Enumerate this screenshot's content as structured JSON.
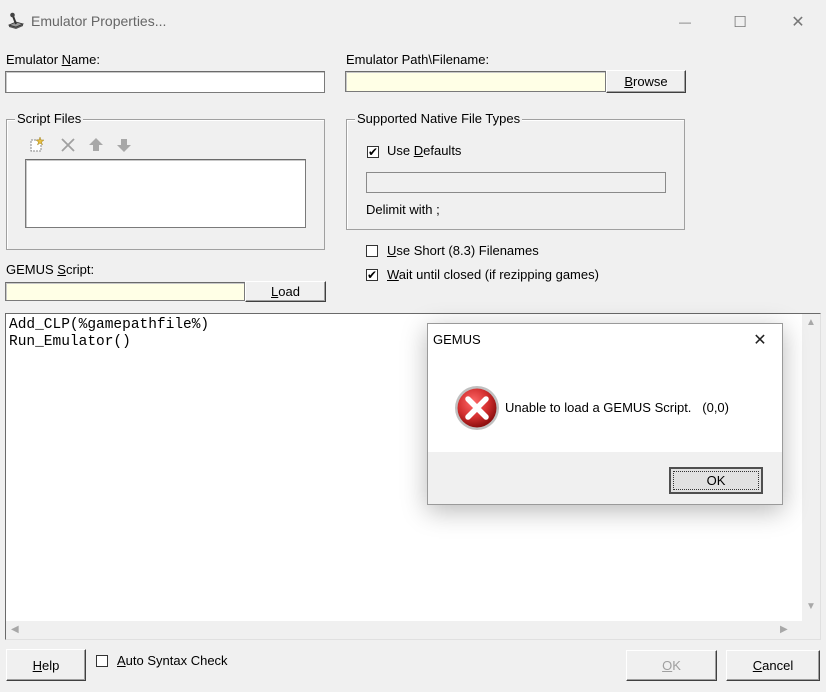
{
  "window": {
    "title": "Emulator Properties...",
    "minimize_glyph": "—",
    "maximize_glyph": "☐",
    "close_glyph": "✕"
  },
  "form": {
    "emulator_name": {
      "label_pre": "Emulator ",
      "label_u": "N",
      "label_post": "ame:",
      "value": ""
    },
    "emulator_path": {
      "label": "Emulator Path\\Filename:",
      "value": ""
    },
    "browse_button": {
      "label_u": "B",
      "label_post": "rowse"
    },
    "script_files": {
      "title": "Script Files",
      "items": []
    },
    "native_types": {
      "title": "Supported Native File Types",
      "use_defaults": {
        "label_pre": "Use ",
        "label_u": "D",
        "label_post": "efaults",
        "checked": true
      },
      "value": "",
      "delimit_label": "Delimit with ;"
    },
    "short_filenames": {
      "label_u": "U",
      "label_post": "se Short (8.3) Filenames",
      "checked": false
    },
    "wait_until_closed": {
      "label_u": "W",
      "label_post": "ait until closed (if rezipping games)",
      "checked": true
    },
    "gemus_script": {
      "label_pre": "GEMUS ",
      "label_u": "S",
      "label_post": "cript:",
      "value": ""
    },
    "load_button": {
      "label_u": "L",
      "label_post": "oad"
    },
    "script_text": "Add_CLP(%gamepathfile%)\nRun_Emulator()"
  },
  "footer": {
    "help_button": {
      "label_u": "H",
      "label_post": "elp"
    },
    "auto_syntax": {
      "label_u": "A",
      "label_post": "uto Syntax Check",
      "checked": false
    },
    "ok_button": {
      "label_u": "O",
      "label_post": "K",
      "disabled": true
    },
    "cancel_button": {
      "label_u": "C",
      "label_post": "ancel"
    }
  },
  "dialog": {
    "title": "GEMUS",
    "message": "Unable to load a GEMUS Script.   (0,0)",
    "ok_label": "OK",
    "icon": "error-icon",
    "close_glyph": "✕"
  },
  "colors": {
    "window_bg": "#f0f0f0",
    "field_yellow": "#ffffe6",
    "error_red": "#d32f2f"
  }
}
